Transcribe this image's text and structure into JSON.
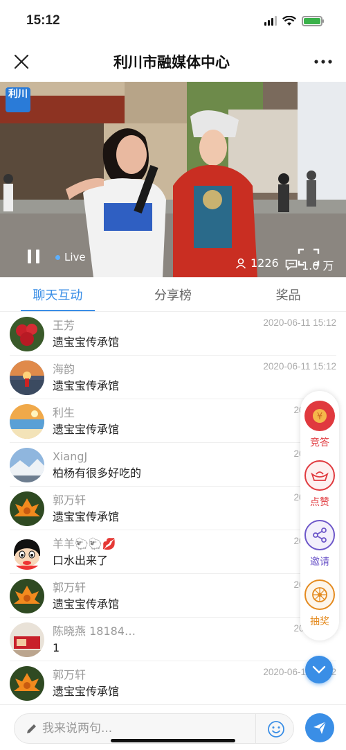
{
  "status_bar": {
    "time": "15:12"
  },
  "nav": {
    "title": "利川市融媒体中心"
  },
  "video": {
    "logo_text": "利川",
    "live_label": "Live",
    "viewers": "1226",
    "comments": "1.0 万"
  },
  "tabs": [
    {
      "label": "聊天互动",
      "active": true
    },
    {
      "label": "分享榜",
      "active": false
    },
    {
      "label": "奖品",
      "active": false
    }
  ],
  "messages": [
    {
      "name": "王芳",
      "content": "遗宝宝传承馆",
      "time": "2020-06-11 15:12",
      "avatar": "flower-red"
    },
    {
      "name": "海韵",
      "content": "遗宝宝传承馆",
      "time": "2020-06-11 15:12",
      "avatar": "sunset"
    },
    {
      "name": "利生",
      "content": "遗宝宝传承馆",
      "time": "2020-06-1",
      "avatar": "beach"
    },
    {
      "name": "XiangJ",
      "content": "柏杨有很多好吃的",
      "time": "2020-06-1",
      "avatar": "snow"
    },
    {
      "name": "郭万轩",
      "content": "遗宝宝传承馆",
      "time": "2020-06-1",
      "avatar": "flower-orange"
    },
    {
      "name": "羊羊🐑🐑💋",
      "content": "口水出来了",
      "time": "2020-06-1",
      "avatar": "cartoon"
    },
    {
      "name": "郭万轩",
      "content": "遗宝宝传承馆",
      "time": "2020-06-1",
      "avatar": "flower-orange"
    },
    {
      "name": "陈晓燕 18184…",
      "content": "1",
      "time": "2020-06-1",
      "avatar": "red-box"
    },
    {
      "name": "郭万轩",
      "content": "遗宝宝传承馆",
      "time": "2020-06-11 15:12",
      "avatar": "flower-orange"
    }
  ],
  "side_menu": [
    {
      "label": "竞答",
      "color": "#e0393e",
      "icon": "coin-icon"
    },
    {
      "label": "点赞",
      "color": "#e0393e",
      "icon": "gold-ingot-icon"
    },
    {
      "label": "邀请",
      "color": "#6d57c9",
      "icon": "share-icon"
    },
    {
      "label": "抽奖",
      "color": "#e48a1e",
      "icon": "lottery-wheel-icon"
    }
  ],
  "input": {
    "placeholder": "我来说两句..."
  },
  "colors": {
    "accent": "#3a8ee6"
  }
}
